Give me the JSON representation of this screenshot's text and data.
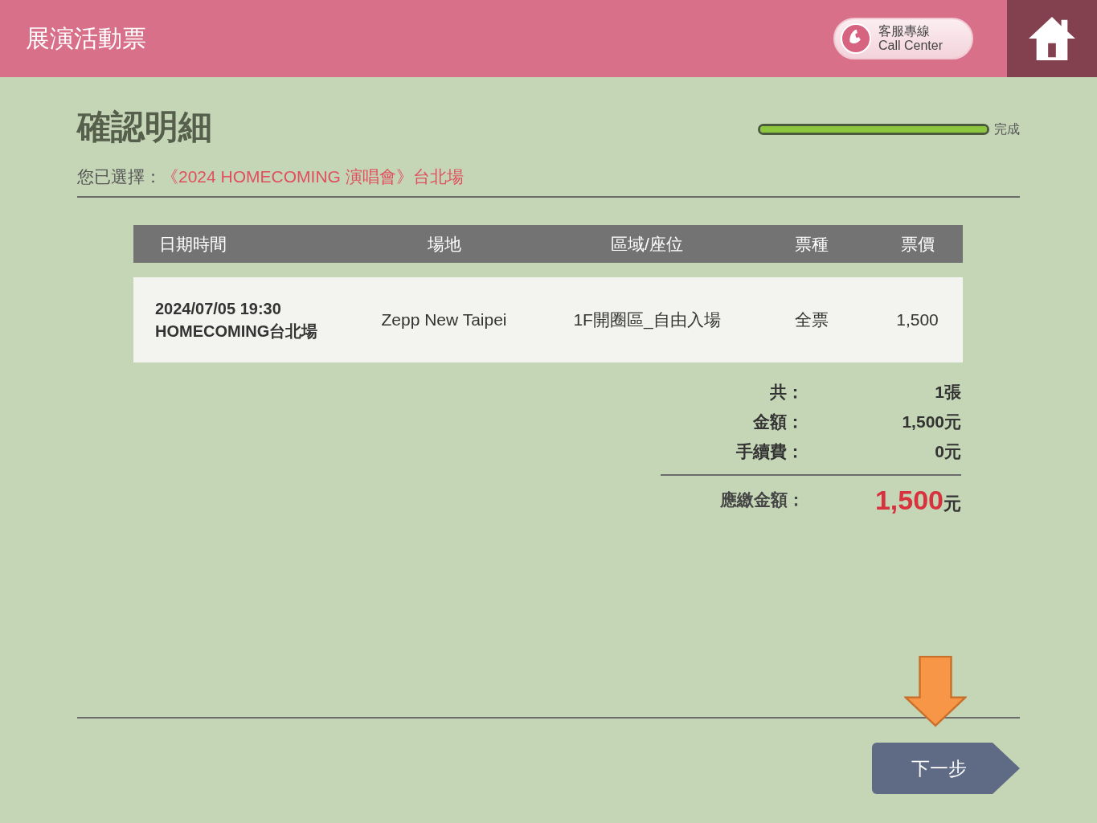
{
  "header": {
    "title": "展演活動票",
    "call_center": {
      "line1": "客服專線",
      "line2": "Call Center"
    }
  },
  "page": {
    "title": "確認明細",
    "progress": {
      "level": 1,
      "label": "完成"
    },
    "selection_label": "您已選擇：",
    "selection_value": "《2024 HOMECOMING 演唱會》台北場"
  },
  "table": {
    "columns": [
      "日期時間",
      "場地",
      "區域/座位",
      "票種",
      "票價"
    ],
    "rows": [
      {
        "cells": [
          [
            "2024/07/05 19:30",
            "HOMECOMING台北場"
          ],
          [
            "Zepp New Taipei"
          ],
          [
            "1F開圈區_自由入場"
          ],
          [
            "全票"
          ],
          [
            "1,500"
          ]
        ]
      }
    ]
  },
  "summary": {
    "lines": [
      {
        "label": "共：",
        "value": "1張"
      },
      {
        "label": "金額：",
        "value": "1,500元"
      },
      {
        "label": "手續費：",
        "value": "0元"
      }
    ],
    "total": {
      "label": "應繳金額：",
      "amount": "1,500",
      "unit": "元"
    }
  },
  "next_button": "下一步"
}
